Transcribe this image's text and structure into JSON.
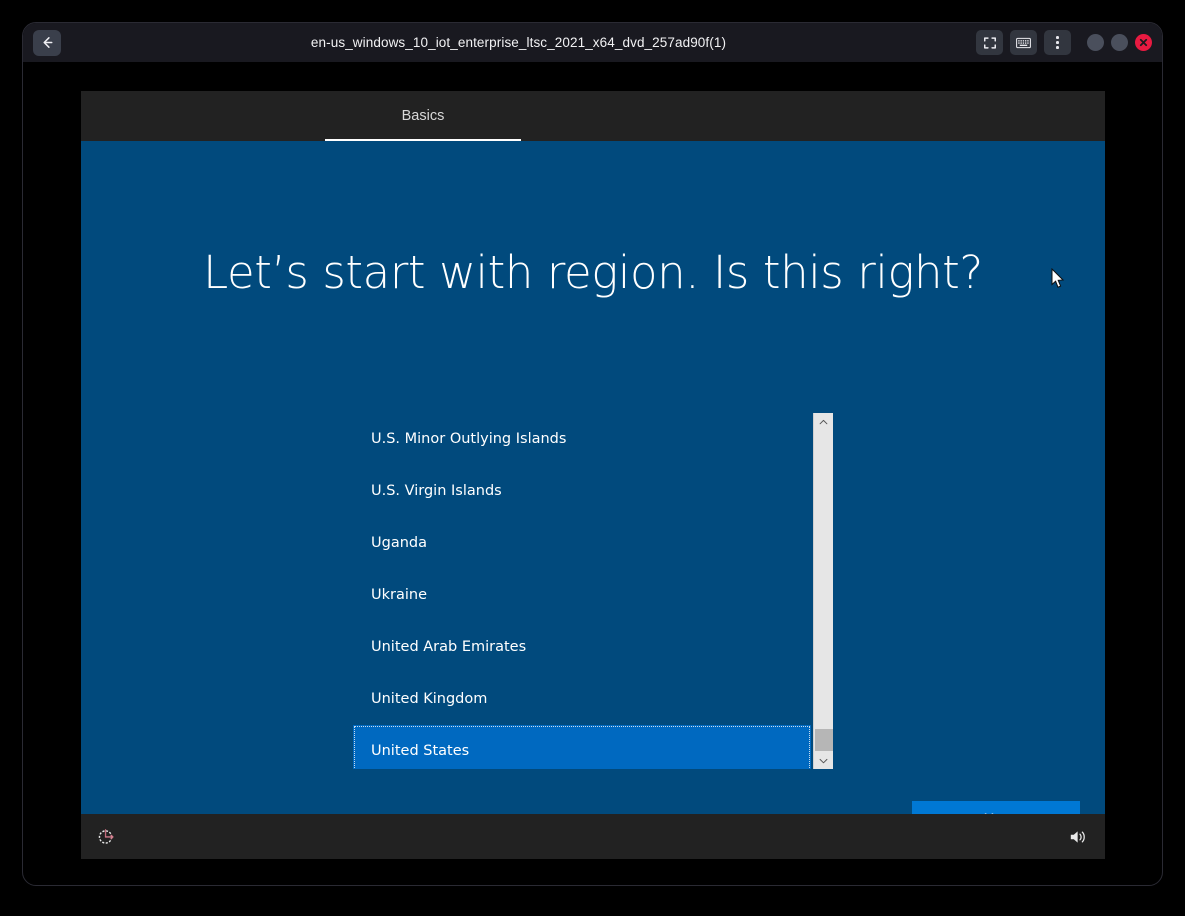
{
  "window": {
    "title": "en-us_windows_10_iot_enterprise_ltsc_2021_x64_dvd_257ad90f(1)",
    "back_label": "Back",
    "fullscreen_label": "Fullscreen",
    "keyboard_label": "Send keystrokes",
    "menu_label": "More options",
    "minimize_label": "Minimize",
    "maximize_label": "Maximize",
    "close_label": "Close"
  },
  "guest": {
    "tab": {
      "label": "Basics"
    },
    "heading": "Let’s start with region. Is this right?",
    "region_list": {
      "items": [
        {
          "label": "U.S. Minor Outlying Islands",
          "selected": false
        },
        {
          "label": "U.S. Virgin Islands",
          "selected": false
        },
        {
          "label": "Uganda",
          "selected": false
        },
        {
          "label": "Ukraine",
          "selected": false
        },
        {
          "label": "United Arab Emirates",
          "selected": false
        },
        {
          "label": "United Kingdom",
          "selected": false
        },
        {
          "label": "United States",
          "selected": true
        }
      ],
      "scrollbar": {
        "up_arrow": "chevron-up",
        "down_arrow": "chevron-down",
        "thumb_position_percent": 89
      }
    },
    "confirm_button": "Yes",
    "bottom_bar": {
      "ease_of_access": "ease-of-access-icon",
      "volume": "volume-icon"
    }
  },
  "colors": {
    "oobe_blue": "#014a7d",
    "selection_blue": "#0069c0",
    "accent_button": "#0078d4",
    "chrome_dark": "#191920",
    "guest_bar": "#222222",
    "close_red": "#e81a41"
  }
}
